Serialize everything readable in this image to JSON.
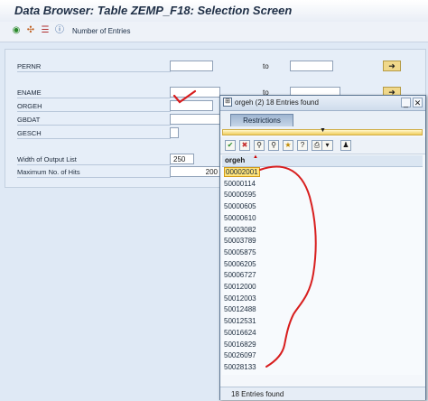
{
  "window": {
    "title": "Data Browser: Table ZEMP_F18: Selection Screen"
  },
  "toolbar": {
    "icons": [
      "execute-icon",
      "hierarchy-icon",
      "layout-icon",
      "info-icon"
    ],
    "number_of_entries_label": "Number of Entries"
  },
  "form": {
    "pernr_label": "PERNR",
    "ename_label": "ENAME",
    "orgeh_label": "ORGEH",
    "gbdat_label": "GBDAT",
    "gesch_label": "GESCH",
    "to_label": "to",
    "width_label": "Width of Output List",
    "width_value": "250",
    "max_hits_label": "Maximum No. of Hits",
    "max_hits_value": "200"
  },
  "popup": {
    "title": "orgeh (2)   18 Entries found",
    "tab_restrictions": "Restrictions",
    "column_header": "orgeh",
    "entries": [
      "00002001",
      "50000114",
      "50000595",
      "50000605",
      "50000610",
      "50003082",
      "50003789",
      "50005875",
      "50006205",
      "50006727",
      "50012000",
      "50012003",
      "50012488",
      "50012531",
      "50016624",
      "50016829",
      "50026097",
      "50028133"
    ],
    "selected_index": 0,
    "status": "18 Entries found"
  },
  "colors": {
    "annotation": "#d81e1e",
    "accent": "#f0d88a"
  }
}
